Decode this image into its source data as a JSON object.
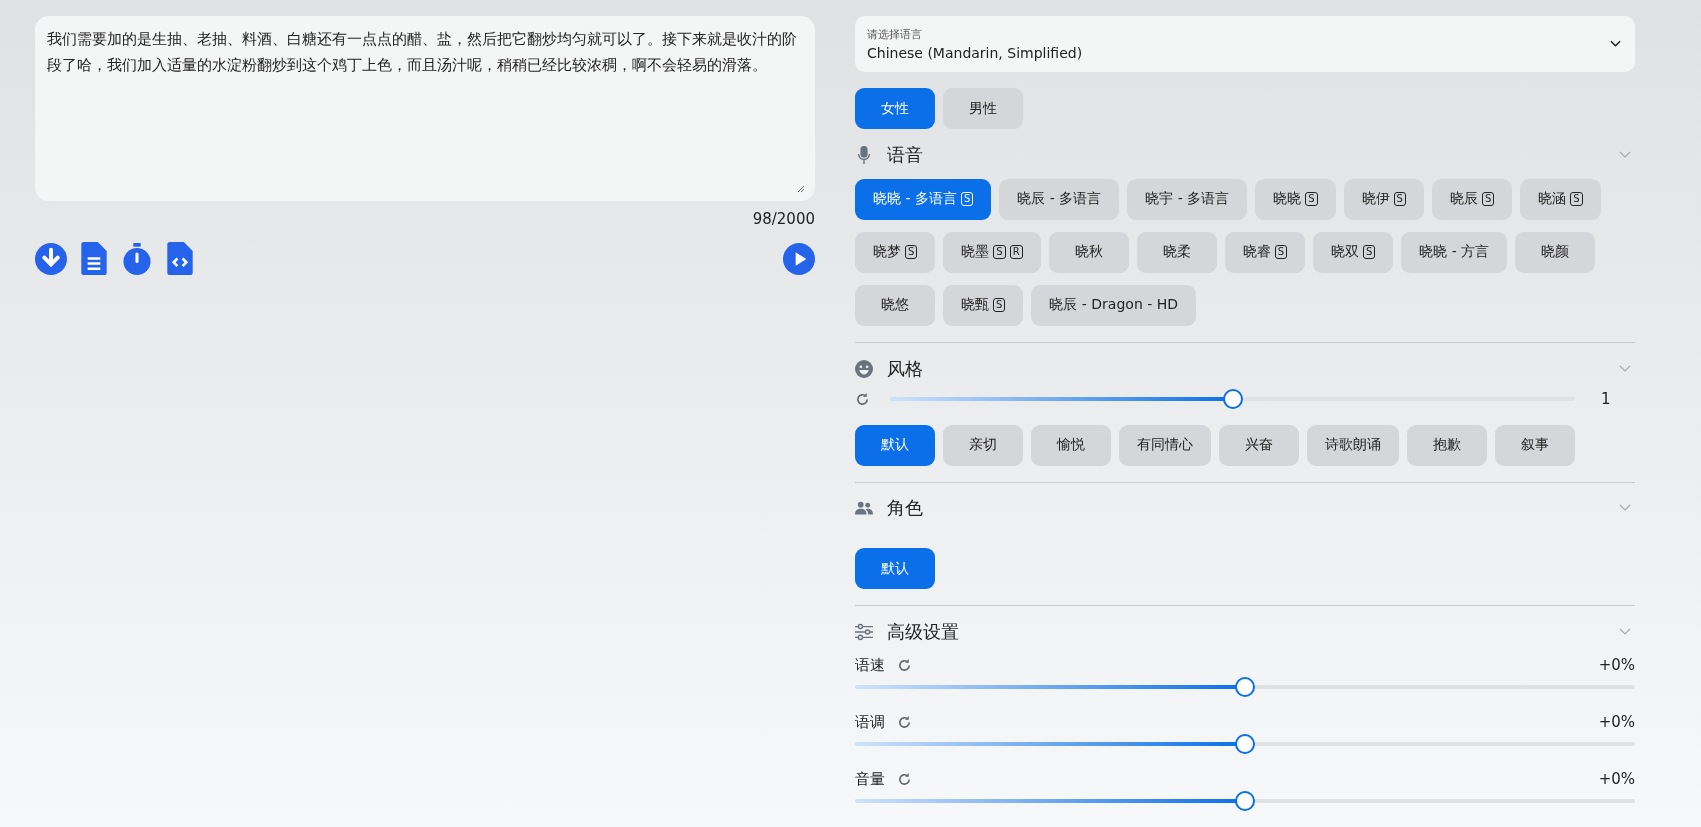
{
  "editor": {
    "text": "我们需要加的是生抽、老抽、料酒、白糖还有一点点的醋、盐，然后把它翻炒均匀就可以了。接下来就是收汁的阶段了哈，我们加入适量的水淀粉翻炒到这个鸡丁上色，而且汤汁呢，稍稍已经比较浓稠，啊不会轻易的滑落。",
    "counter": "98/2000"
  },
  "language": {
    "label": "请选择语言",
    "value": "Chinese (Mandarin, Simplified)"
  },
  "genders": [
    {
      "label": "女性",
      "selected": true
    },
    {
      "label": "男性",
      "selected": false
    }
  ],
  "voice": {
    "title": "语音",
    "items": [
      {
        "name": "晓晓 - 多语言",
        "badges": [
          "S"
        ],
        "selected": true
      },
      {
        "name": "晓辰 - 多语言",
        "selected": false
      },
      {
        "name": "晓宇 - 多语言",
        "selected": false
      },
      {
        "name": "晓晓",
        "badges": [
          "S"
        ],
        "selected": false
      },
      {
        "name": "晓伊",
        "badges": [
          "S"
        ],
        "selected": false
      },
      {
        "name": "晓辰",
        "badges": [
          "S"
        ],
        "selected": false
      },
      {
        "name": "晓涵",
        "badges": [
          "S"
        ],
        "selected": false
      },
      {
        "name": "晓梦",
        "badges": [
          "S"
        ],
        "selected": false
      },
      {
        "name": "晓墨",
        "badges": [
          "S",
          "R"
        ],
        "selected": false
      },
      {
        "name": "晓秋",
        "selected": false
      },
      {
        "name": "晓柔",
        "selected": false
      },
      {
        "name": "晓睿",
        "badges": [
          "S"
        ],
        "selected": false
      },
      {
        "name": "晓双",
        "badges": [
          "S"
        ],
        "selected": false
      },
      {
        "name": "晓晓 - 方言",
        "selected": false
      },
      {
        "name": "晓颜",
        "selected": false
      },
      {
        "name": "晓悠",
        "selected": false
      },
      {
        "name": "晓甄",
        "badges": [
          "S"
        ],
        "selected": false
      },
      {
        "name": "晓辰 - Dragon - HD",
        "selected": false
      }
    ]
  },
  "style": {
    "title": "风格",
    "level": 0.5,
    "reading": "1",
    "items": [
      {
        "name": "默认",
        "selected": true
      },
      {
        "name": "亲切",
        "selected": false
      },
      {
        "name": "愉悦",
        "selected": false
      },
      {
        "name": "有同情心",
        "selected": false
      },
      {
        "name": "兴奋",
        "selected": false
      },
      {
        "name": "诗歌朗诵",
        "selected": false
      },
      {
        "name": "抱歉",
        "selected": false
      },
      {
        "name": "叙事",
        "selected": false
      }
    ]
  },
  "role": {
    "title": "角色",
    "items": [
      {
        "name": "默认",
        "selected": true
      }
    ]
  },
  "advanced": {
    "title": "高级设置",
    "sliders": [
      {
        "label": "语速",
        "reading": "+0%",
        "level": 0.5
      },
      {
        "label": "语调",
        "reading": "+0%",
        "level": 0.5
      },
      {
        "label": "音量",
        "reading": "+0%",
        "level": 0.5
      }
    ]
  }
}
